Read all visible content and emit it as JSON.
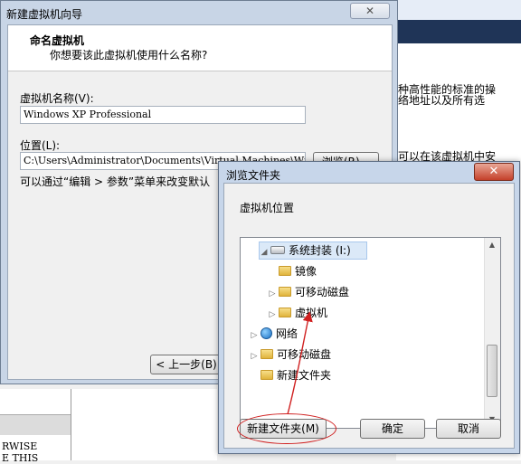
{
  "background_app": {
    "lines": [
      "种高性能的标准的操",
      "络地址以及所有选",
      "可以在该虚拟机中安"
    ]
  },
  "background_fragments": {
    "line1": "RWISE",
    "line2": "E THIS"
  },
  "wizard": {
    "title": "新建虚拟机向导",
    "close_glyph": "✕",
    "heading": "命名虚拟机",
    "subheading": "你想要该此虚拟机使用什么名称?",
    "name_label": "虚拟机名称(V):",
    "name_value": "Windows XP Professional",
    "location_label": "位置(L):",
    "location_value": "C:\\Users\\Administrator\\Documents\\Virtual Machines\\Wi",
    "browse_button": "浏览(R)...",
    "hint_text": "可以通过“编辑 > 参数”菜单来改变默认",
    "back_button": "< 上一步(B)"
  },
  "browse_dialog": {
    "title": "浏览文件夹",
    "close_glyph": "✕",
    "label": "虚拟机位置",
    "tree": [
      {
        "label": "系统封装 (I:)",
        "icon": "drive-icon",
        "expander": "◢",
        "selected": true
      },
      {
        "label": "镜像",
        "icon": "folder-icon",
        "expander": ""
      },
      {
        "label": "可移动磁盘",
        "icon": "folder-icon",
        "expander": "▷"
      },
      {
        "label": "虚拟机",
        "icon": "folder-icon",
        "expander": "▷"
      },
      {
        "label": "网络",
        "icon": "network-icon",
        "expander": "▷"
      },
      {
        "label": "可移动磁盘",
        "icon": "folder-icon",
        "expander": "▷"
      },
      {
        "label": "新建文件夹",
        "icon": "folder-icon",
        "expander": ""
      }
    ],
    "new_folder_button": "新建文件夹(M)",
    "ok_button": "确定",
    "cancel_button": "取消"
  },
  "annotation_color": "#d02020"
}
